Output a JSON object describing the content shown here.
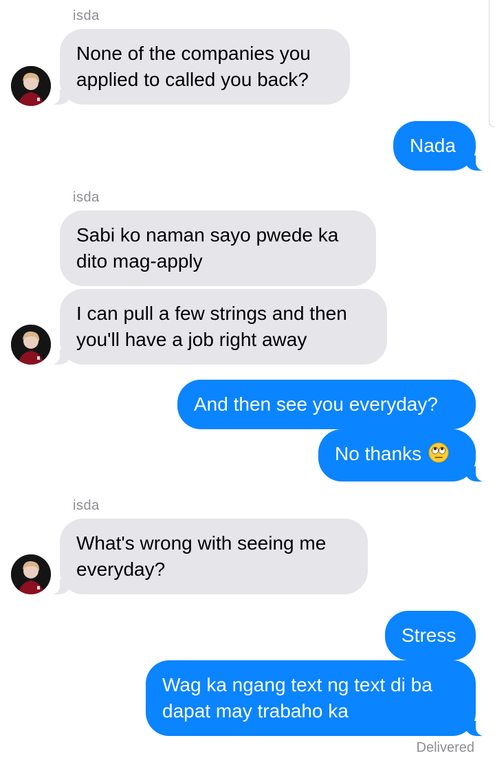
{
  "contact": {
    "name": "isda"
  },
  "messages": [
    {
      "from": "them",
      "text": "None of the companies you applied to called you back?"
    },
    {
      "from": "me",
      "text": "Nada"
    },
    {
      "from": "them",
      "text": "Sabi ko naman sayo pwede ka dito mag-apply"
    },
    {
      "from": "them",
      "text": "I can pull a few strings and then you'll have a job right away"
    },
    {
      "from": "me",
      "text": "And then see you everyday?"
    },
    {
      "from": "me",
      "text": "No thanks",
      "emoji": "face-with-rolling-eyes-icon"
    },
    {
      "from": "them",
      "text": "What's wrong with seeing me everyday?"
    },
    {
      "from": "me",
      "text": "Stress"
    },
    {
      "from": "me",
      "text": "Wag ka ngang text ng text di ba dapat may trabaho ka"
    }
  ],
  "status": "Delivered",
  "colors": {
    "outgoing": "#0a84ff",
    "incoming": "#e5e5ea",
    "meta": "#8e8e93"
  }
}
